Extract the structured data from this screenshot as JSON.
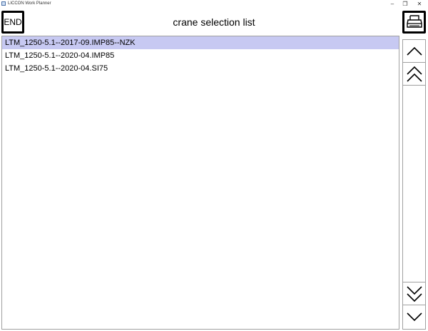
{
  "window": {
    "title": "LICCON Work Planner",
    "minimize_glyph": "–",
    "maximize_glyph": "❐",
    "close_glyph": "✕"
  },
  "header": {
    "end_label": "END",
    "title": "crane selection list",
    "print_icon": "printer-icon"
  },
  "list": {
    "items": [
      {
        "label": "LTM_1250-5.1--2017-09.IMP85--NZK",
        "selected": true
      },
      {
        "label": "LTM_1250-5.1--2020-04.IMP85",
        "selected": false
      },
      {
        "label": "LTM_1250-5.1--2020-04.SI75",
        "selected": false
      }
    ]
  },
  "scroll": {
    "up_icon": "chevron-up-icon",
    "page_up_icon": "double-chevron-up-icon",
    "page_down_icon": "double-chevron-down-icon",
    "down_icon": "chevron-down-icon"
  },
  "colors": {
    "selection": "#c7c9f2",
    "border": "#000000"
  }
}
